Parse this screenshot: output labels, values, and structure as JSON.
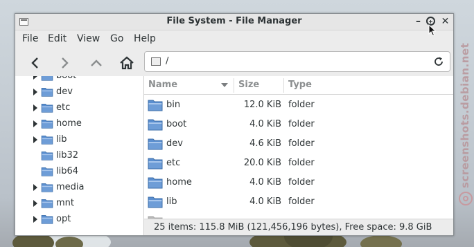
{
  "window": {
    "title": "File System - File Manager",
    "minimize": "–",
    "close": "✕"
  },
  "menu": [
    "File",
    "Edit",
    "View",
    "Go",
    "Help"
  ],
  "toolbar": {
    "path": "/",
    "buttons": [
      "back-icon",
      "forward-icon",
      "up-icon",
      "home-icon"
    ]
  },
  "sidebar": {
    "items": [
      {
        "label": "boot",
        "expandable": true
      },
      {
        "label": "dev",
        "expandable": true
      },
      {
        "label": "etc",
        "expandable": true
      },
      {
        "label": "home",
        "expandable": true
      },
      {
        "label": "lib",
        "expandable": true
      },
      {
        "label": "lib32",
        "expandable": false
      },
      {
        "label": "lib64",
        "expandable": false
      },
      {
        "label": "media",
        "expandable": true
      },
      {
        "label": "mnt",
        "expandable": true
      },
      {
        "label": "opt",
        "expandable": true
      }
    ]
  },
  "columns": [
    "Name",
    "Size",
    "Type"
  ],
  "files": [
    {
      "name": "bin",
      "size": "12.0 KiB",
      "type": "folder"
    },
    {
      "name": "boot",
      "size": "4.0 KiB",
      "type": "folder"
    },
    {
      "name": "dev",
      "size": "4.6 KiB",
      "type": "folder"
    },
    {
      "name": "etc",
      "size": "20.0 KiB",
      "type": "folder"
    },
    {
      "name": "home",
      "size": "4.0 KiB",
      "type": "folder"
    },
    {
      "name": "lib",
      "size": "4.0 KiB",
      "type": "folder"
    }
  ],
  "status": "25 items: 115.8 MiB (121,456,196 bytes), Free space: 9.8 GiB",
  "watermark": "screenshots.debian.net",
  "colors": {
    "folder": "#5b8fd0",
    "folder_light": "#a8c6ec",
    "accent": "#2e3436"
  }
}
